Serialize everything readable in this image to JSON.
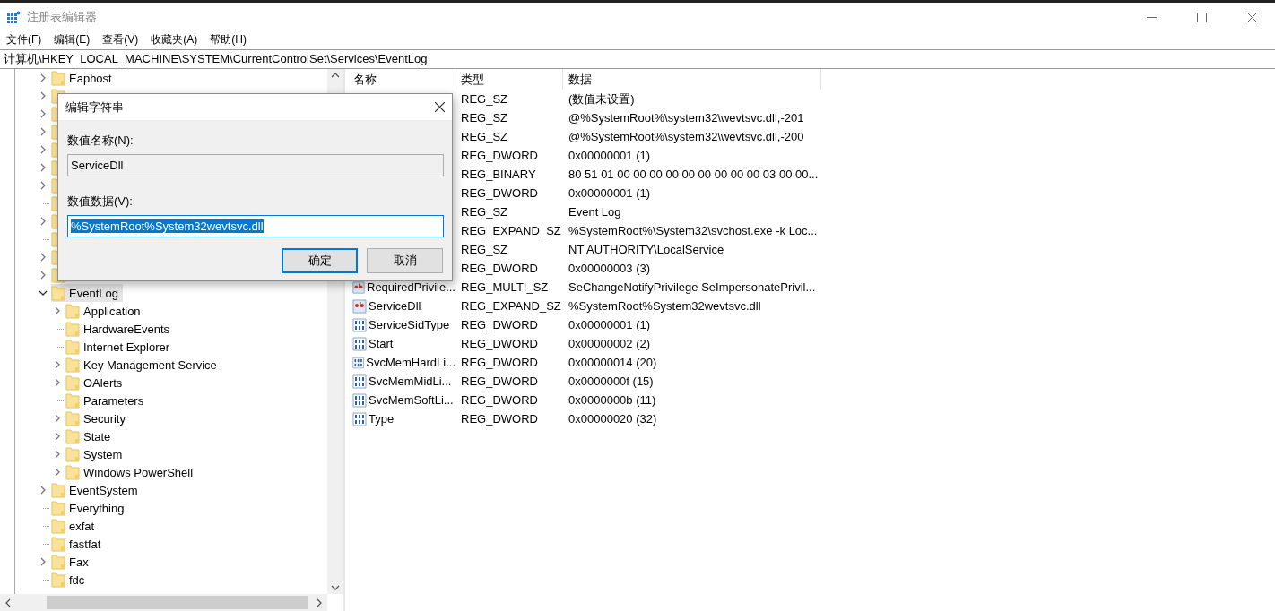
{
  "window": {
    "title": "注册表编辑器"
  },
  "menu": [
    "文件(F)",
    "编辑(E)",
    "查看(V)",
    "收藏夹(A)",
    "帮助(H)"
  ],
  "address": "计算机\\HKEY_LOCAL_MACHINE\\SYSTEM\\CurrentControlSet\\Services\\EventLog",
  "tree": [
    {
      "label": "Eaphost",
      "has_children": true,
      "expanded": false,
      "selected": false
    },
    {
      "kind": "covered",
      "has_children": true
    },
    {
      "kind": "covered",
      "has_children": true
    },
    {
      "kind": "covered",
      "has_children": true
    },
    {
      "kind": "covered",
      "has_children": true
    },
    {
      "kind": "covered",
      "has_children": true
    },
    {
      "kind": "covered",
      "has_children": true
    },
    {
      "kind": "covered",
      "has_children": false
    },
    {
      "kind": "covered",
      "has_children": true
    },
    {
      "kind": "covered",
      "has_children": false
    },
    {
      "kind": "covered",
      "has_children": true
    },
    {
      "kind": "covered",
      "has_children": true
    },
    {
      "label": "EventLog",
      "has_children": true,
      "expanded": true,
      "selected": true,
      "children": [
        {
          "label": "Application",
          "has_children": true,
          "expanded": false,
          "selected": false
        },
        {
          "label": "HardwareEvents",
          "has_children": false,
          "expanded": false,
          "selected": false
        },
        {
          "label": "Internet Explorer",
          "has_children": false,
          "expanded": false,
          "selected": false
        },
        {
          "label": "Key Management Service",
          "has_children": true,
          "expanded": false,
          "selected": false
        },
        {
          "label": "OAlerts",
          "has_children": true,
          "expanded": false,
          "selected": false
        },
        {
          "label": "Parameters",
          "has_children": false,
          "expanded": false,
          "selected": false
        },
        {
          "label": "Security",
          "has_children": true,
          "expanded": false,
          "selected": false
        },
        {
          "label": "State",
          "has_children": true,
          "expanded": false,
          "selected": false
        },
        {
          "label": "System",
          "has_children": true,
          "expanded": false,
          "selected": false
        },
        {
          "label": "Windows PowerShell",
          "has_children": true,
          "expanded": false,
          "selected": false
        }
      ]
    },
    {
      "label": "EventSystem",
      "has_children": true,
      "expanded": false,
      "selected": false
    },
    {
      "label": "Everything",
      "has_children": false,
      "expanded": false,
      "selected": false
    },
    {
      "label": "exfat",
      "has_children": false,
      "expanded": false,
      "selected": false
    },
    {
      "label": "fastfat",
      "has_children": false,
      "expanded": false,
      "selected": false
    },
    {
      "label": "Fax",
      "has_children": true,
      "expanded": false,
      "selected": false
    },
    {
      "label": "fdc",
      "has_children": false,
      "expanded": false,
      "selected": false
    }
  ],
  "columns": [
    "名称",
    "类型",
    "数据"
  ],
  "values": [
    {
      "type": "REG_SZ",
      "data": "(数值未设置)"
    },
    {
      "type": "REG_SZ",
      "data": "@%SystemRoot%\\system32\\wevtsvc.dll,-201"
    },
    {
      "type": "REG_SZ",
      "data": "@%SystemRoot%\\system32\\wevtsvc.dll,-200"
    },
    {
      "type": "REG_DWORD",
      "data": "0x00000001 (1)"
    },
    {
      "type": "REG_BINARY",
      "data": "80 51 01 00 00 00 00 00 00 00 00 00 03 00 00..."
    },
    {
      "type": "REG_DWORD",
      "data": "0x00000001 (1)"
    },
    {
      "type": "REG_SZ",
      "data": "Event Log"
    },
    {
      "type": "REG_EXPAND_SZ",
      "data": "%SystemRoot%\\System32\\svchost.exe -k Loc..."
    },
    {
      "type": "REG_SZ",
      "data": "NT AUTHORITY\\LocalService"
    },
    {
      "type": "REG_DWORD",
      "data": "0x00000003 (3)"
    },
    {
      "kind": "string",
      "name": "RequiredPrivile...",
      "type": "REG_MULTI_SZ",
      "data": "SeChangeNotifyPrivilege SeImpersonatePrivil..."
    },
    {
      "kind": "string",
      "name": "ServiceDll",
      "type": "REG_EXPAND_SZ",
      "data": "%SystemRoot%System32wevtsvc.dll"
    },
    {
      "kind": "number",
      "name": "ServiceSidType",
      "type": "REG_DWORD",
      "data": "0x00000001 (1)"
    },
    {
      "kind": "number",
      "name": "Start",
      "type": "REG_DWORD",
      "data": "0x00000002 (2)"
    },
    {
      "kind": "number",
      "name": "SvcMemHardLi...",
      "type": "REG_DWORD",
      "data": "0x00000014 (20)"
    },
    {
      "kind": "number",
      "name": "SvcMemMidLi...",
      "type": "REG_DWORD",
      "data": "0x0000000f (15)"
    },
    {
      "kind": "number",
      "name": "SvcMemSoftLi...",
      "type": "REG_DWORD",
      "data": "0x0000000b (11)"
    },
    {
      "kind": "number",
      "name": "Type",
      "type": "REG_DWORD",
      "data": "0x00000020 (32)"
    }
  ],
  "dialog": {
    "title": "编辑字符串",
    "fields": [
      {
        "kind": "readonly",
        "label": "数值名称(N):",
        "value": "ServiceDll",
        "selected": false
      },
      {
        "kind": "editable",
        "label": "数值数据(V):",
        "value": "%SystemRoot%System32wevtsvc.dll",
        "selected": true
      }
    ],
    "buttons": [
      {
        "label": "确定",
        "default": true
      },
      {
        "label": "取消",
        "default": false
      }
    ]
  }
}
